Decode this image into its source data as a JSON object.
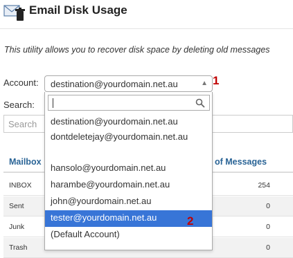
{
  "page": {
    "title": "Email Disk Usage",
    "description": "This utility allows you to recover disk space by deleting old messages",
    "icon": "mail-trash-icon"
  },
  "account": {
    "label": "Account:",
    "selected_value": "destination@yourdomain.net.au"
  },
  "search": {
    "label": "Search:",
    "placeholder": "Search"
  },
  "dropdown": {
    "search_value": "",
    "options": [
      "destination@yourdomain.net.au",
      "dontdeletejay@yourdomain.net.au",
      "hansolo@yourdomain.net.au",
      "harambe@yourdomain.net.au",
      "john@yourdomain.net.au",
      "tester@yourdomain.net.au",
      "(Default Account)"
    ],
    "highlighted_option": "tester@yourdomain.net.au"
  },
  "annotations": [
    "1",
    "2"
  ],
  "table": {
    "columns": [
      "Mailbox",
      "of Messages"
    ],
    "rows": [
      {
        "mailbox": "INBOX",
        "messages": "254"
      },
      {
        "mailbox": "Sent",
        "messages": "0"
      },
      {
        "mailbox": "Junk",
        "messages": "0"
      },
      {
        "mailbox": "Trash",
        "messages": "0"
      }
    ]
  },
  "colors": {
    "highlight": "#3875d7",
    "annotation": "#c00000",
    "header_link": "#2a6496"
  }
}
